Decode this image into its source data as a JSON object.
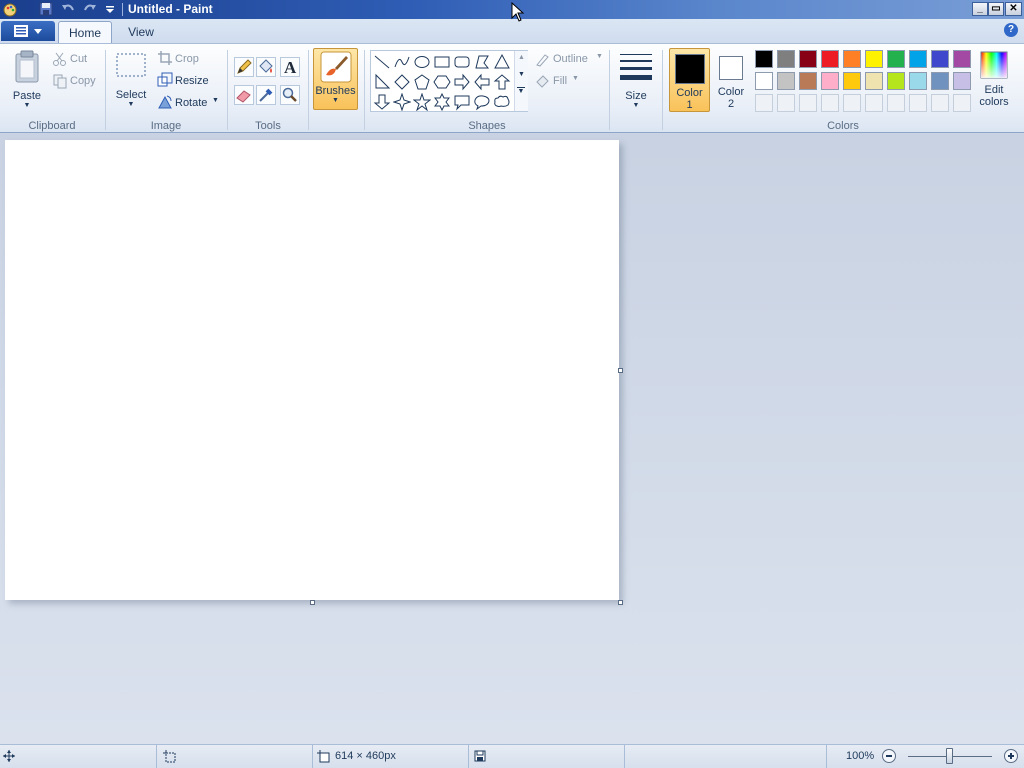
{
  "window": {
    "title": "Untitled - Paint",
    "controls": [
      "minimize",
      "restore",
      "close"
    ]
  },
  "quick_access": [
    "paint-icon",
    "save-icon",
    "undo-icon",
    "redo-icon",
    "customize-dropdown-icon"
  ],
  "tabs": {
    "home": "Home",
    "view": "View"
  },
  "ribbon": {
    "clipboard": {
      "group": "Clipboard",
      "paste": "Paste",
      "cut": "Cut",
      "copy": "Copy"
    },
    "image": {
      "group": "Image",
      "select": "Select",
      "crop": "Crop",
      "resize": "Resize",
      "rotate": "Rotate"
    },
    "tools": {
      "group": "Tools",
      "items": [
        "pencil-icon",
        "fill-icon",
        "text-icon",
        "eraser-icon",
        "color-picker-icon",
        "magnifier-icon"
      ]
    },
    "brushes": {
      "label": "Brushes"
    },
    "shapes": {
      "group": "Shapes",
      "outline": "Outline",
      "fill": "Fill"
    },
    "size": {
      "label": "Size"
    },
    "colors": {
      "group": "Colors",
      "color1": {
        "label_line1": "Color",
        "label_line2": "1",
        "value": "#000000"
      },
      "color2": {
        "label_line1": "Color",
        "label_line2": "2",
        "value": "#ffffff"
      },
      "edit_line1": "Edit",
      "edit_line2": "colors",
      "palette_row1": [
        "#000000",
        "#7f7f7f",
        "#880015",
        "#ed1c24",
        "#ff7f27",
        "#fff200",
        "#22b14c",
        "#00a2e8",
        "#3f48cc",
        "#a349a4"
      ],
      "palette_row2": [
        "#ffffff",
        "#c3c3c3",
        "#b97a57",
        "#ffaec9",
        "#ffc90e",
        "#efe4b0",
        "#b5e61d",
        "#99d9ea",
        "#7092be",
        "#c8bfe7"
      ]
    }
  },
  "status": {
    "canvas_size": "614 × 460px",
    "zoom": "100%"
  }
}
